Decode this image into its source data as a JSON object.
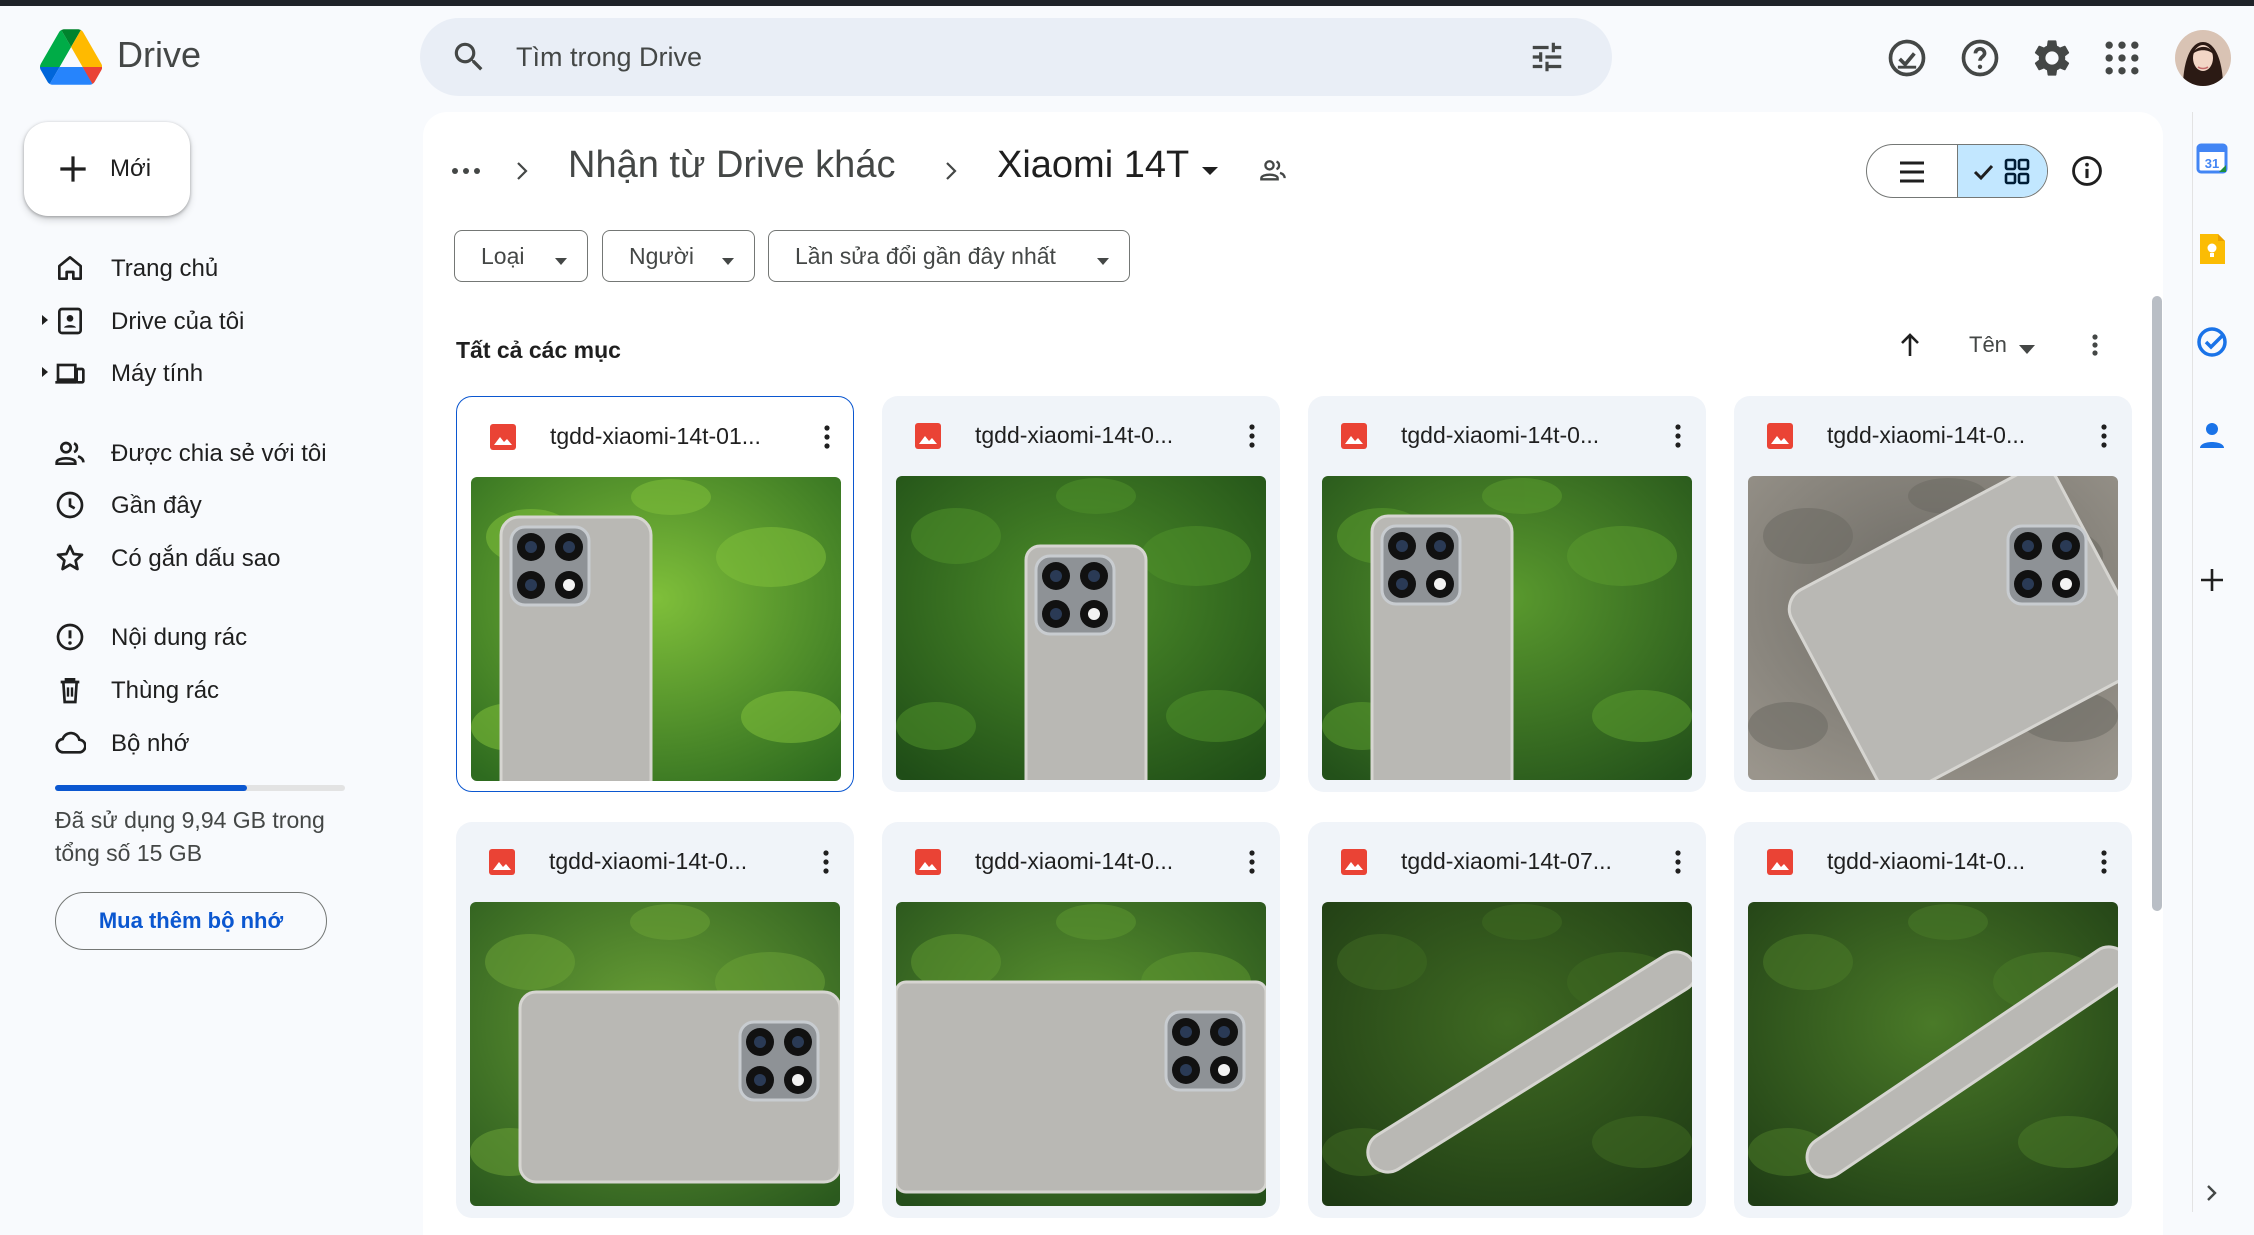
{
  "app": {
    "name": "Drive"
  },
  "search": {
    "placeholder": "Tìm trong Drive"
  },
  "sidebar": {
    "new_label": "Mới",
    "items": [
      {
        "label": "Trang chủ",
        "icon": "home-icon"
      },
      {
        "label": "Drive của tôi",
        "icon": "my-drive-icon"
      },
      {
        "label": "Máy tính",
        "icon": "computer-icon"
      },
      {
        "label": "Được chia sẻ với tôi",
        "icon": "people-icon"
      },
      {
        "label": "Gần đây",
        "icon": "clock-icon"
      },
      {
        "label": "Có gắn dấu sao",
        "icon": "star-icon"
      },
      {
        "label": "Nội dung rác",
        "icon": "spam-icon"
      },
      {
        "label": "Thùng rác",
        "icon": "trash-icon"
      },
      {
        "label": "Bộ nhớ",
        "icon": "cloud-icon"
      }
    ],
    "storage": {
      "used_fraction": 0.663,
      "text": "Đã sử dụng 9,94 GB trong tổng số 15 GB",
      "buy_label": "Mua thêm bộ nhớ"
    }
  },
  "breadcrumb": {
    "parent": "Nhận từ Drive khác",
    "current": "Xiaomi 14T"
  },
  "filters": {
    "type": "Loại",
    "people": "Người",
    "modified": "Lần sửa đổi gần đây nhất"
  },
  "list": {
    "section_title": "Tất cả các mục",
    "sort_label": "Tên"
  },
  "files": [
    {
      "name": "tgdd-xiaomi-14t-01...",
      "selected": true
    },
    {
      "name": "tgdd-xiaomi-14t-0...",
      "selected": false
    },
    {
      "name": "tgdd-xiaomi-14t-0...",
      "selected": false
    },
    {
      "name": "tgdd-xiaomi-14t-0...",
      "selected": false
    },
    {
      "name": "tgdd-xiaomi-14t-0...",
      "selected": false
    },
    {
      "name": "tgdd-xiaomi-14t-0...",
      "selected": false
    },
    {
      "name": "tgdd-xiaomi-14t-07...",
      "selected": false
    },
    {
      "name": "tgdd-xiaomi-14t-0...",
      "selected": false
    }
  ],
  "colors": {
    "accent": "#0b57d0",
    "selected_view": "#c2e7ff",
    "file_image_icon": "#ea4335"
  }
}
